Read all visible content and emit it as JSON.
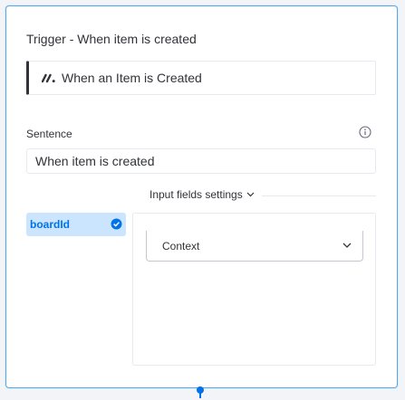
{
  "card": {
    "title": "Trigger - When item is created",
    "trigger": {
      "icon": "monday-logo-icon",
      "label": "When an Item is Created"
    },
    "sentence": {
      "label": "Sentence",
      "value": "When item is created",
      "info_icon": "info-icon"
    },
    "input_fields": {
      "toggle_label": "Input fields settings",
      "field_pill": "boardId",
      "field_pill_icon": "check-circle-icon",
      "select_value": "Context"
    }
  },
  "colors": {
    "accent": "#0073ea",
    "pill_bg": "#cce5ff",
    "card_border": "#5aa9e6",
    "text": "#323338"
  }
}
